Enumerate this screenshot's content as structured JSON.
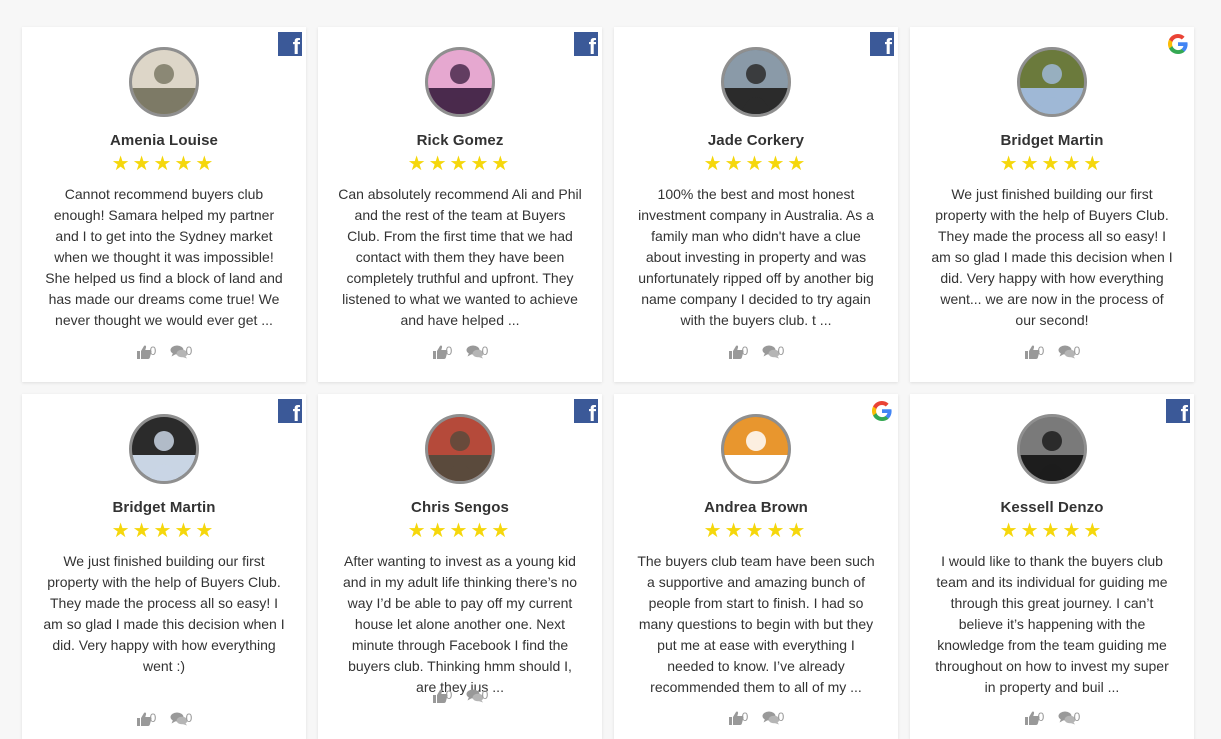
{
  "reviews": [
    {
      "name": "Amenia Louise",
      "source": "facebook",
      "stars": "★★★★★",
      "text": "Cannot recommend buyers club enough! Samara helped my partner and I to get into the Sydney market when we thought it was impossible! She helped us find a block of land and has made our dreams come true! We never thought we would ever get ...",
      "likes": "0",
      "comments": "0",
      "avatar_colors": [
        "#7d7a66",
        "#ddd6c8"
      ]
    },
    {
      "name": "Rick Gomez",
      "source": "facebook",
      "stars": "★★★★★",
      "text": "Can absolutely recommend Ali and Phil and the rest of the team at Buyers Club. From the first time that we had contact with them they have been completely truthful and upfront. They listened to what we wanted to achieve and have helped ...",
      "likes": "0",
      "comments": "0",
      "avatar_colors": [
        "#4a2a4d",
        "#e6a8d0"
      ]
    },
    {
      "name": "Jade Corkery",
      "source": "facebook",
      "stars": "★★★★★",
      "text": "100% the best and most honest investment company in Australia. As a family man who didn't have a clue about investing in property and was unfortunately ripped off by another big name company I decided to try again with the buyers club. t ...",
      "likes": "0",
      "comments": "0",
      "avatar_colors": [
        "#2b2b2b",
        "#8a9aa8"
      ]
    },
    {
      "name": "Bridget Martin",
      "source": "google",
      "stars": "★★★★★",
      "text": "We just finished building our first property with the help of Buyers Club. They made the process all so easy! I am so glad I made this decision when I did. Very happy with how everything went... we are now in the process of our second!",
      "likes": "0",
      "comments": "0",
      "avatar_colors": [
        "#9fb8d6",
        "#6b7a3c"
      ]
    },
    {
      "name": "Bridget Martin",
      "source": "facebook",
      "stars": "★★★★★",
      "text": "We just finished building our first property with the help of Buyers Club. They made the process all so easy! I am so glad I made this decision when I did. Very happy with how everything went :)",
      "likes": "0",
      "comments": "0",
      "avatar_colors": [
        "#c9d5e4",
        "#2b2b2b"
      ]
    },
    {
      "name": "Chris Sengos",
      "source": "facebook",
      "stars": "★★★★★",
      "text": "After wanting to invest as a young kid and in my adult life thinking there’s no way I’d be able to pay off my current house let alone another one. Next minute through Facebook I find the buyers club. Thinking hmm should I, are they jus ...",
      "likes": "0",
      "comments": "0",
      "avatar_colors": [
        "#5a4a3c",
        "#b54a3a"
      ]
    },
    {
      "name": "Andrea Brown",
      "source": "google",
      "stars": "★★★★★",
      "text": "The buyers club team have been such a supportive and amazing bunch of people from start to finish. I had so many questions to begin with but they put me at ease with everything I needed to know. I’ve already recommended them to all of my ...",
      "likes": "0",
      "comments": "0",
      "avatar_colors": [
        "#ffffff",
        "#e8962e"
      ]
    },
    {
      "name": "Kessell Denzo",
      "source": "facebook",
      "stars": "★★★★★",
      "text": "I would like to thank the buyers club team and its individual for guiding me through this great journey. I can’t believe it’s happening with the knowledge from the team guiding me throughout on how to invest my super in property and buil ...",
      "likes": "0",
      "comments": "0",
      "avatar_colors": [
        "#1d1d1d",
        "#7a7a7a"
      ]
    }
  ],
  "colors": {
    "star": "#f5d70c",
    "facebook": "#3b5998",
    "text": "#333333",
    "muted": "#999999"
  },
  "icons": {
    "like": "thumbs-up-icon",
    "comment": "comment-icon",
    "facebook": "facebook-icon",
    "google": "google-icon"
  }
}
